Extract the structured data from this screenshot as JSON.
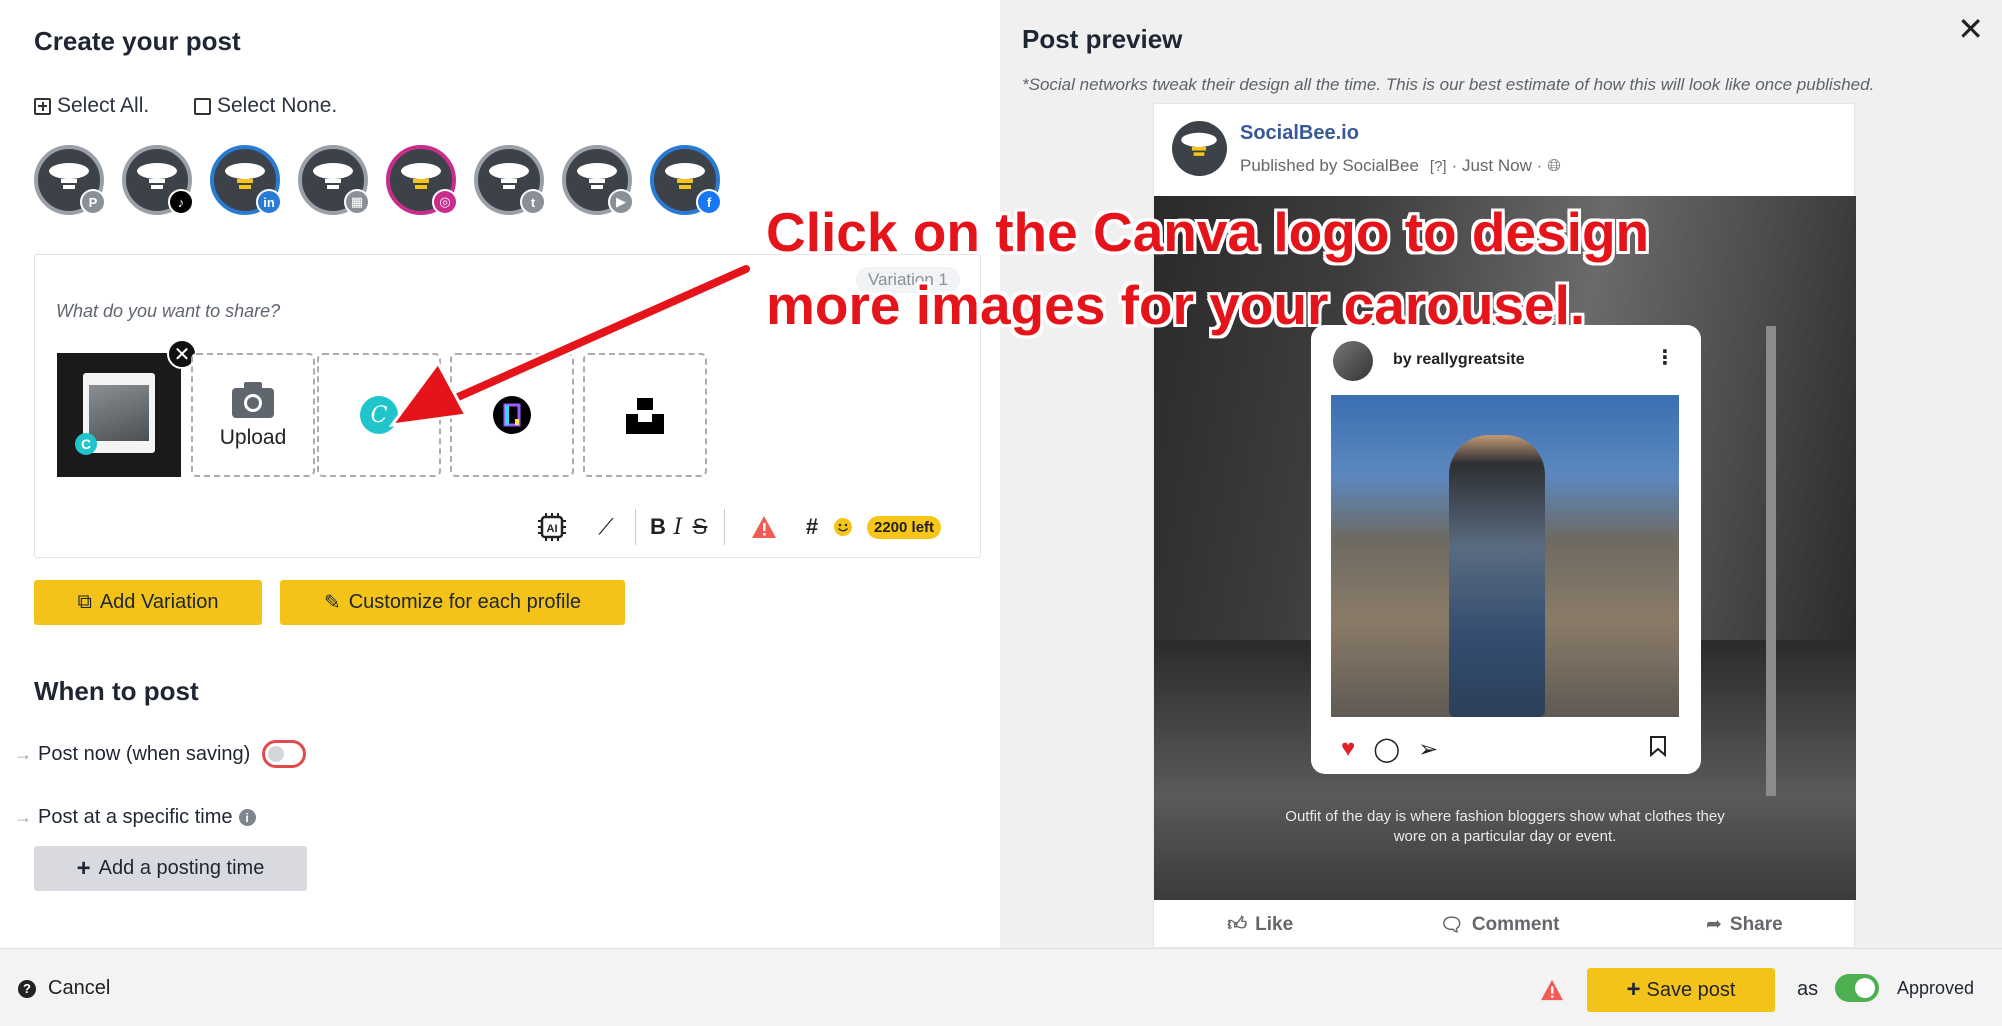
{
  "composer": {
    "title": "Create your post",
    "select_all": "Select All.",
    "select_none": "Select None.",
    "profiles": [
      {
        "network": "pinterest",
        "badge_icon": "pinterest-icon",
        "badge_color": "#8a8f98",
        "selected": false
      },
      {
        "network": "tiktok",
        "badge_icon": "tiktok-icon",
        "badge_color": "#000000",
        "selected": false
      },
      {
        "network": "linkedin",
        "badge_icon": "linkedin-icon",
        "badge_color": "#2a7bd4",
        "selected": true
      },
      {
        "network": "google-business",
        "badge_icon": "google-business-icon",
        "badge_color": "#8a8f98",
        "selected": false
      },
      {
        "network": "instagram",
        "badge_icon": "instagram-icon",
        "badge_color": "#c92d8c",
        "selected": true
      },
      {
        "network": "twitter",
        "badge_icon": "twitter-icon",
        "badge_color": "#8a8f98",
        "selected": false
      },
      {
        "network": "youtube",
        "badge_icon": "youtube-icon",
        "badge_color": "#8a8f98",
        "selected": false
      },
      {
        "network": "facebook",
        "badge_icon": "facebook-icon",
        "badge_color": "#1877f2",
        "selected": true
      }
    ],
    "variation_tag": "Variation 1",
    "placeholder": "What do you want to share?",
    "upload_label": "Upload",
    "chars_left": "2200 left",
    "add_variation": "Add Variation",
    "customize": "Customize for each profile"
  },
  "schedule": {
    "title": "When to post",
    "post_now": "Post now (when saving)",
    "post_specific": "Post at a specific time",
    "add_posting_time": "Add a posting time"
  },
  "preview": {
    "title": "Post preview",
    "note": "*Social networks tweak their design all the time. This is our best estimate of how this will look like once published.",
    "page_name": "SocialBee.io",
    "published_by": "Published by",
    "publisher": "SocialBee",
    "help": "[?]",
    "time": "· Just Now ·",
    "ig_user": "by reallygreatsite",
    "caption": "Outfit of the day is where fashion bloggers show what clothes they wore on a particular day or event.",
    "like": "Like",
    "comment": "Comment",
    "share": "Share"
  },
  "annotation": {
    "line1": "Click on the Canva logo to design",
    "line2": "more images for your carousel."
  },
  "footer": {
    "cancel": "Cancel",
    "save_post": "Save post",
    "as": "as",
    "approved": "Approved"
  },
  "colors": {
    "accent_yellow": "#f3c31a",
    "annotation_red": "#e5141a",
    "canva_teal": "#20c4cb",
    "facebook_blue": "#385898",
    "approved_green": "#4caf50"
  }
}
